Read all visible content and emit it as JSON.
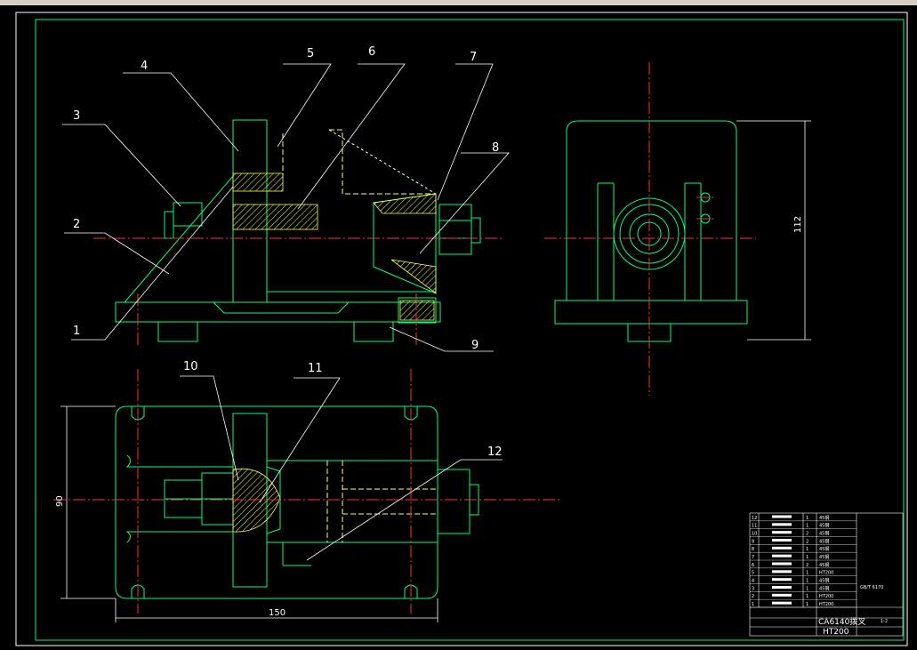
{
  "drawing": {
    "balloons": [
      "1",
      "2",
      "3",
      "4",
      "5",
      "6",
      "7",
      "8",
      "9",
      "10",
      "11",
      "12"
    ],
    "dimensions": {
      "front_width": "150",
      "top_height": "90",
      "side_height": "112"
    },
    "title_block": {
      "part_title": "CA6140拨叉",
      "material": "HT200",
      "scale": "1:2",
      "rows": [
        {
          "no": "12",
          "qty": "1",
          "mat": "45钢"
        },
        {
          "no": "11",
          "qty": "1",
          "mat": "45钢"
        },
        {
          "no": "10",
          "qty": "2",
          "mat": "45钢"
        },
        {
          "no": "9",
          "qty": "2",
          "mat": "45钢"
        },
        {
          "no": "8",
          "qty": "1",
          "mat": "45钢"
        },
        {
          "no": "7",
          "qty": "1",
          "mat": "45钢"
        },
        {
          "no": "6",
          "qty": "2",
          "mat": "45钢"
        },
        {
          "no": "5",
          "qty": "1",
          "mat": "HT200"
        },
        {
          "no": "4",
          "qty": "1",
          "mat": "45钢"
        },
        {
          "no": "3",
          "qty": "1",
          "mat": "45钢"
        },
        {
          "no": "2",
          "qty": "1",
          "mat": "HT200"
        },
        {
          "no": "1",
          "qty": "1",
          "mat": "HT200"
        }
      ],
      "std_note": "GB/T 6170"
    }
  },
  "colors": {
    "outline": "#00ff80",
    "center": "#ff3030",
    "hidden": "#ffff60",
    "leader": "#ffffff",
    "hatch": "#ffff40"
  }
}
